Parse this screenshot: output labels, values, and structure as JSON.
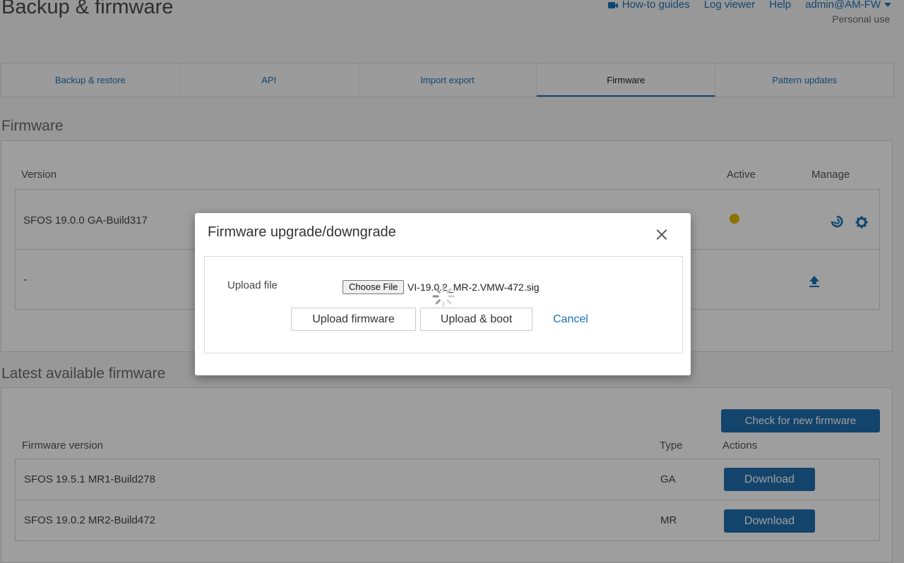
{
  "header": {
    "title": "Backup & firmware",
    "links": [
      "How-to guides",
      "Log viewer",
      "Help",
      "admin@AM-FW"
    ],
    "subline": "Personal use"
  },
  "tabs": [
    {
      "label": "Backup & restore",
      "active": false
    },
    {
      "label": "API",
      "active": false
    },
    {
      "label": "Import export",
      "active": false
    },
    {
      "label": "Firmware",
      "active": true
    },
    {
      "label": "Pattern updates",
      "active": false
    }
  ],
  "firmware": {
    "heading": "Firmware",
    "columns": {
      "version": "Version",
      "active": "Active",
      "manage": "Manage"
    },
    "rows": [
      {
        "version": "SFOS 19.0.0 GA-Build317"
      },
      {
        "version": "-"
      }
    ]
  },
  "latest": {
    "heading": "Latest available firmware",
    "check_button": "Check for new firmware",
    "columns": {
      "version": "Firmware version",
      "type": "Type",
      "actions": "Actions"
    },
    "rows": [
      {
        "version": "SFOS 19.5.1 MR1-Build278",
        "type": "GA",
        "action": "Download"
      },
      {
        "version": "SFOS 19.0.2 MR2-Build472",
        "type": "MR",
        "action": "Download"
      }
    ]
  },
  "modal": {
    "title": "Firmware upgrade/downgrade",
    "upload_label": "Upload file",
    "choose_file": "Choose File",
    "file_name": "VI-19.0.2_MR-2.VMW-472.sig",
    "upload_firmware": "Upload firmware",
    "upload_boot": "Upload & boot",
    "cancel": "Cancel"
  },
  "colors": {
    "accent": "#1a73b8",
    "primary_button": "#1f6fae",
    "active_dot": "#e6b800"
  }
}
